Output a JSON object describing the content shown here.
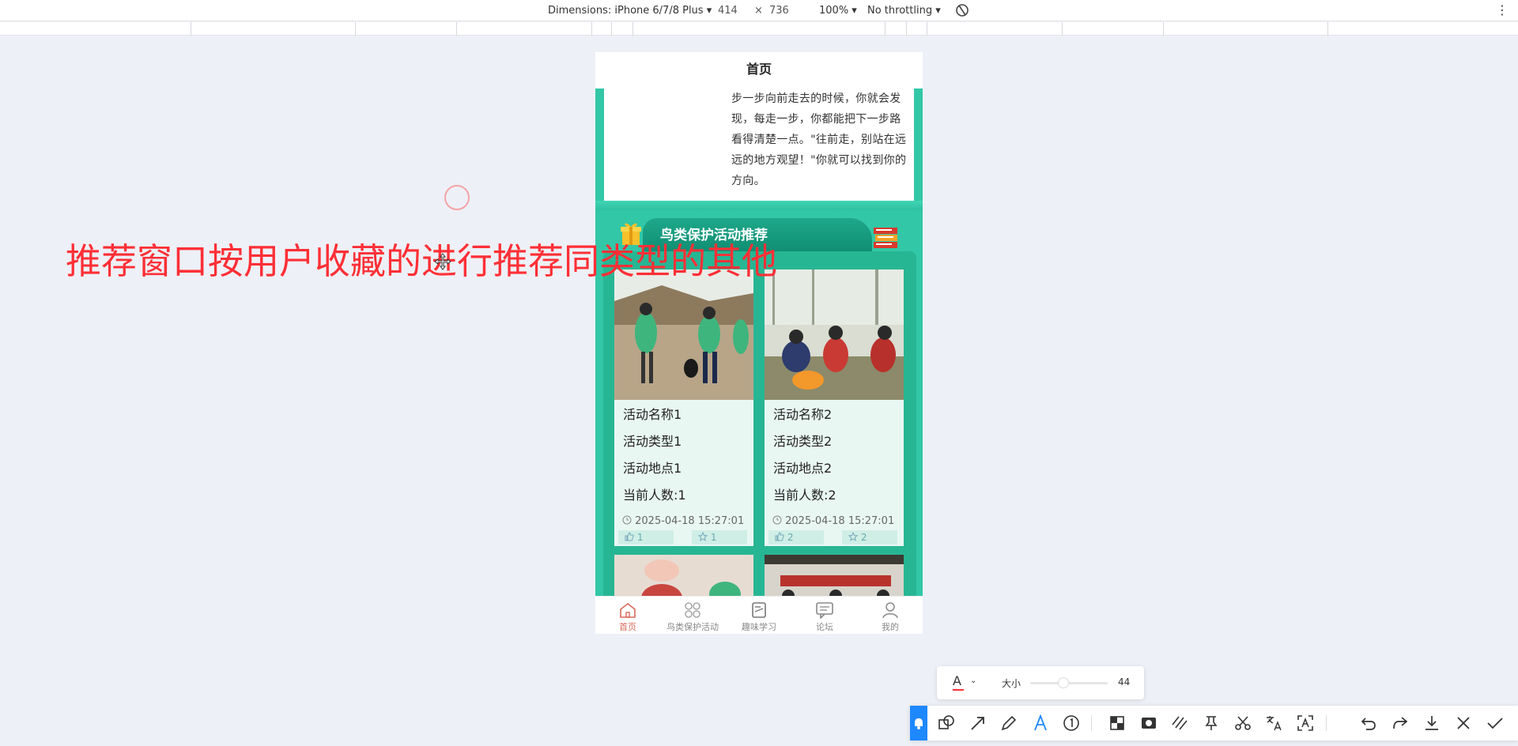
{
  "devtools": {
    "dimensions_label": "Dimensions: iPhone 6/7/8 Plus ▾",
    "width": "414",
    "times": "×",
    "height": "736",
    "zoom": "100% ▾",
    "throttling": "No throttling ▾"
  },
  "phone": {
    "header_title": "首页",
    "article_text": "步一步向前走去的时候，你就会发现，每走一步，你都能把下一步路看得清楚一点。\"往前走，别站在远远的地方观望！\"你就可以找到你的方向。",
    "section_title": "鸟类保护活动推荐",
    "activities": [
      {
        "name": "活动名称1",
        "type": "活动类型1",
        "location": "活动地点1",
        "count": "当前人数:1",
        "time": "2025-04-18 15:27:01",
        "likes": "1",
        "favorites": "1"
      },
      {
        "name": "活动名称2",
        "type": "活动类型2",
        "location": "活动地点2",
        "count": "当前人数:2",
        "time": "2025-04-18 15:27:01",
        "likes": "2",
        "favorites": "2"
      }
    ],
    "tabbar": [
      {
        "label": "首页",
        "icon": "home-icon",
        "active": true
      },
      {
        "label": "鸟类保护活动",
        "icon": "grid-icon",
        "active": false
      },
      {
        "label": "趣味学习",
        "icon": "book-icon",
        "active": false
      },
      {
        "label": "论坛",
        "icon": "forum-icon",
        "active": false
      },
      {
        "label": "我的",
        "icon": "user-icon",
        "active": false
      }
    ]
  },
  "annotation": {
    "text": "推荐窗口按用户收藏的进行推荐同类型的其他",
    "color": "#ff2f36"
  },
  "screenshot_tool": {
    "size_label": "大小",
    "size_value": "44"
  },
  "colors": {
    "teal": "#32c7a6",
    "teal_dark": "#0f8c72",
    "active_tab": "#d96a5a",
    "tool_accent": "#1e88ff"
  }
}
